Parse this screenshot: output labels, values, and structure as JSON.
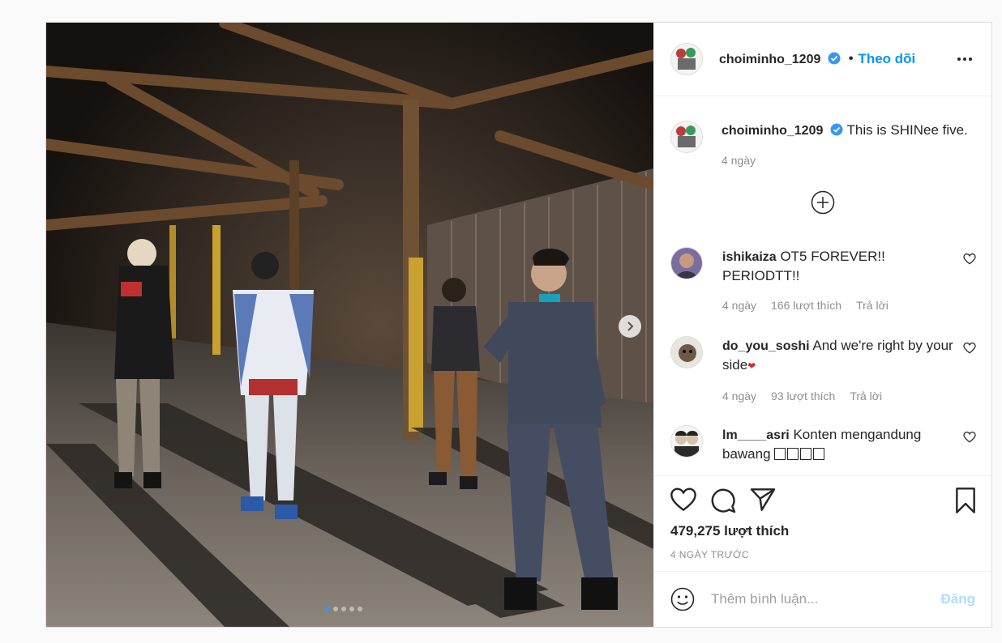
{
  "post": {
    "username": "choiminho_1209",
    "follow_separator": "•",
    "follow_label": "Theo dõi",
    "caption": {
      "username": "choiminho_1209",
      "text": "This is SHINee five.",
      "time": "4 ngày"
    },
    "likes": "479,275 lượt thích",
    "timestamp": "4 NGÀY TRƯỚC",
    "carousel": {
      "count": 5,
      "active": 0
    }
  },
  "comments": [
    {
      "username": "ishikaiza",
      "text": "OT5 FOREVER!! PERIODTT!!",
      "time": "4 ngày",
      "likes": "166 lượt thích",
      "reply": "Trả lời"
    },
    {
      "username": "do_you_soshi",
      "text": "And we're right by your side",
      "emoji": "❤",
      "time": "4 ngày",
      "likes": "93 lượt thích",
      "reply": "Trả lời"
    },
    {
      "username": "lm____asri",
      "text": "Konten mengandung bawang"
    }
  ],
  "add_comment": {
    "placeholder": "Thêm bình luận...",
    "post_label": "Đăng"
  },
  "colors": {
    "link_blue": "#0095f6",
    "verified_blue": "#3897f0",
    "muted": "#8e8e8e"
  },
  "icons": [
    "verified-badge-icon",
    "more-options-icon",
    "load-more-comments-icon",
    "heart-icon",
    "comment-icon",
    "share-icon",
    "bookmark-icon",
    "emoji-icon",
    "chevron-right-icon"
  ]
}
